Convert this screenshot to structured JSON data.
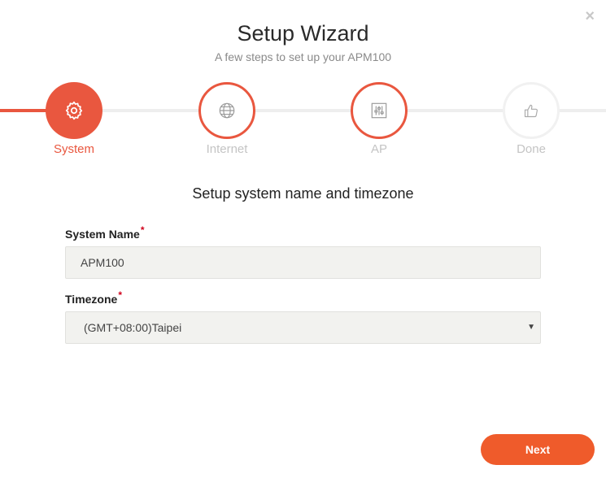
{
  "dialog": {
    "title": "Setup Wizard",
    "subtitle": "A few steps to set up your APM100",
    "close_glyph": "×"
  },
  "steps": [
    {
      "label": "System",
      "icon": "gear-icon",
      "state": "active"
    },
    {
      "label": "Internet",
      "icon": "globe-icon",
      "state": "pending"
    },
    {
      "label": "AP",
      "icon": "sliders-icon",
      "state": "pending"
    },
    {
      "label": "Done",
      "icon": "thumbs-up-icon",
      "state": "idle"
    }
  ],
  "form": {
    "section_title": "Setup system name and timezone",
    "required_marker": "*",
    "system_name": {
      "label": "System Name",
      "value": "APM100"
    },
    "timezone": {
      "label": "Timezone",
      "value": "(GMT+08:00)Taipei"
    }
  },
  "footer": {
    "next_label": "Next"
  },
  "colors": {
    "accent": "#e9573f",
    "button": "#ef5b2b",
    "input_bg": "#f2f2ef",
    "required": "#d0021b"
  }
}
